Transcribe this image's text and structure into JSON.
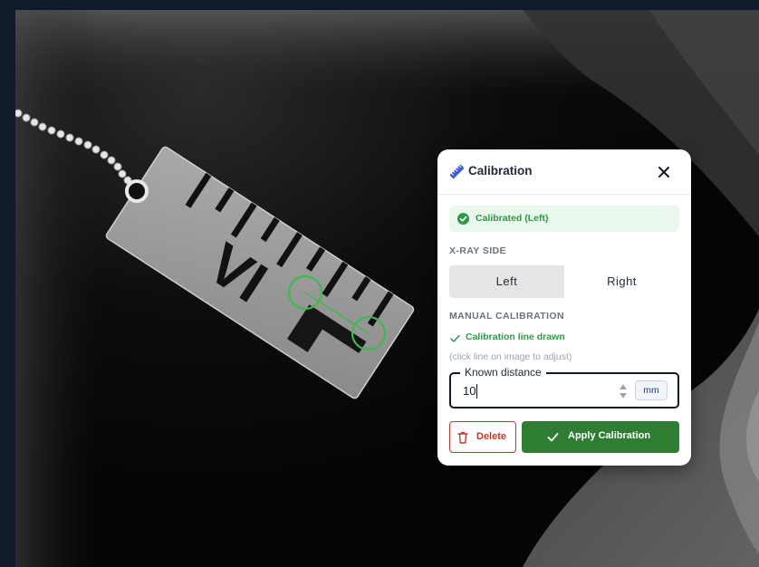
{
  "calibration_panel": {
    "title": "Calibration",
    "status": "Calibrated (Left)",
    "xray_side": {
      "section_label": "X-RAY SIDE",
      "options": [
        "Left",
        "Right"
      ],
      "selected": "Left"
    },
    "manual": {
      "section_label": "MANUAL CALIBRATION",
      "line_status": "Calibration line drawn",
      "hint": "(click line on image to adjust)"
    },
    "known_distance": {
      "label": "Known distance",
      "value": "10",
      "unit": "mm"
    },
    "delete_label": "Delete",
    "apply_label": "Apply Calibration"
  },
  "marker": {
    "text": "VI"
  },
  "colors": {
    "accent_green": "#2e7d32",
    "success_text": "#2e9a47",
    "success_bg": "#e9f7ec",
    "danger": "#c0392b",
    "calibration_line": "#3fb94f",
    "ruler_icon": "#3b5bdb"
  },
  "icons": {
    "panel": "ruler-icon",
    "close": "close-icon",
    "status": "check-circle-icon",
    "line_status": "check-icon",
    "spinner": "spinner-arrows-icon",
    "delete": "trash-icon",
    "apply": "check-icon"
  }
}
